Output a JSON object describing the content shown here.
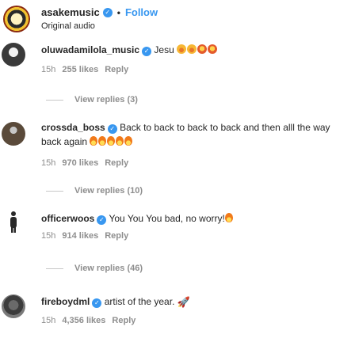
{
  "header": {
    "username": "asakemusic",
    "separator": "•",
    "follow_label": "Follow",
    "subtitle": "Original audio"
  },
  "comments": [
    {
      "username": "oluwadamilola_music",
      "text": "Jesu",
      "emoji": [
        "laugh",
        "laugh",
        "heart",
        "heart"
      ],
      "time": "15h",
      "likes": "255 likes",
      "reply": "Reply",
      "view_replies": "View replies (3)"
    },
    {
      "username": "crossda_boss",
      "text": "Back to back to back to back and then alll the way back again",
      "emoji": [
        "fire",
        "fire",
        "fire",
        "fire",
        "fire"
      ],
      "time": "15h",
      "likes": "970 likes",
      "reply": "Reply",
      "view_replies": "View replies (10)"
    },
    {
      "username": "officerwoos",
      "text": "You You You bad, no worry!",
      "emoji": [
        "fire"
      ],
      "time": "15h",
      "likes": "914 likes",
      "reply": "Reply",
      "view_replies": "View replies (46)"
    },
    {
      "username": "fireboydml",
      "text": "artist of the year.",
      "emoji": [
        "rocket"
      ],
      "time": "15h",
      "likes": "4,356 likes",
      "reply": "Reply"
    }
  ],
  "colors": {
    "accent": "#3897f0",
    "text": "#262626",
    "muted": "#8e8e8e"
  },
  "icons": {
    "verified": "verified-badge-icon"
  }
}
